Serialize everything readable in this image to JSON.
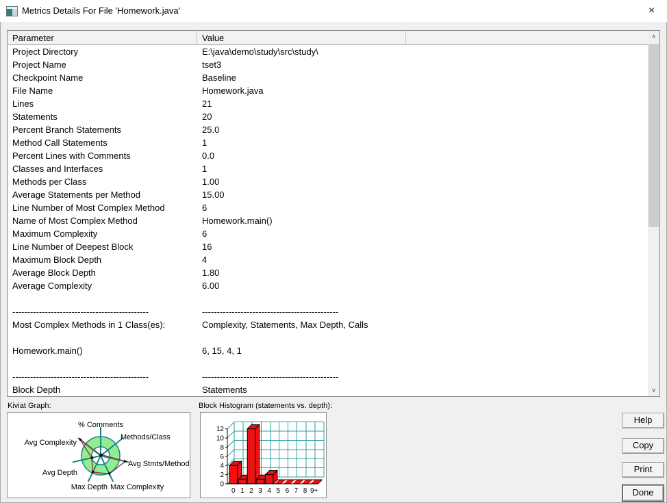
{
  "window": {
    "title": "Metrics Details For File 'Homework.java'",
    "close_glyph": "×",
    "app_icon": "metrics-app-icon"
  },
  "table": {
    "headers": [
      "Parameter",
      "Value",
      ""
    ],
    "rows": [
      [
        "Project Directory",
        "E:\\java\\demo\\study\\src\\study\\"
      ],
      [
        "Project Name",
        "tset3"
      ],
      [
        "Checkpoint Name",
        "Baseline"
      ],
      [
        "File Name",
        "Homework.java"
      ],
      [
        "Lines",
        "21"
      ],
      [
        "Statements",
        "20"
      ],
      [
        "Percent Branch Statements",
        "25.0"
      ],
      [
        "Method Call Statements",
        "1"
      ],
      [
        "Percent Lines with Comments",
        "0.0"
      ],
      [
        "Classes and Interfaces",
        "1"
      ],
      [
        "Methods per Class",
        "1.00"
      ],
      [
        "Average Statements per Method",
        "15.00"
      ],
      [
        "Line Number of Most Complex Method",
        "6"
      ],
      [
        "Name of Most Complex Method",
        "Homework.main()"
      ],
      [
        "Maximum Complexity",
        "6"
      ],
      [
        "Line Number of Deepest Block",
        "16"
      ],
      [
        "Maximum Block Depth",
        "4"
      ],
      [
        "Average Block Depth",
        "1.80"
      ],
      [
        "Average Complexity",
        "6.00"
      ],
      [
        "",
        ""
      ],
      [
        "----------------------------------------------",
        "----------------------------------------------"
      ],
      [
        "Most Complex Methods in 1 Class(es):",
        "Complexity, Statements, Max Depth, Calls"
      ],
      [
        "",
        ""
      ],
      [
        "Homework.main()",
        "6, 15, 4, 1"
      ],
      [
        "",
        ""
      ],
      [
        "----------------------------------------------",
        "----------------------------------------------"
      ],
      [
        "Block Depth",
        "Statements"
      ]
    ]
  },
  "section_labels": {
    "kiviat": "Kiviat Graph:",
    "histogram": "Block Histogram (statements vs. depth):"
  },
  "buttons": {
    "help": "Help",
    "copy": "Copy",
    "print": "Print",
    "done": "Done"
  },
  "scrollbar": {
    "up_glyph": "∧",
    "down_glyph": "∨"
  },
  "chart_data": [
    {
      "type": "radar",
      "title": "Kiviat Graph",
      "axes": [
        "% Comments",
        "Methods/Class",
        "Avg Stmts/Method",
        "Max Complexity",
        "Max Depth",
        "Avg Depth",
        "Avg Complexity"
      ],
      "values_fraction_of_outer_ring": [
        0.04,
        0.08,
        1.32,
        1.05,
        0.95,
        0.48,
        1.38
      ],
      "ring_inner_fraction": 0.47,
      "colors": {
        "ring_fill": "#90ee90",
        "axis": "#1d8383",
        "polygon": "#9c3333",
        "marker": "#000000"
      }
    },
    {
      "type": "bar",
      "title": "Block Histogram (statements vs. depth)",
      "xlabel": "depth",
      "ylabel": "statements",
      "categories": [
        "0",
        "1",
        "2",
        "3",
        "4",
        "5",
        "6",
        "7",
        "8",
        "9+"
      ],
      "values": [
        4,
        1,
        12,
        1,
        2,
        0,
        0,
        0,
        0,
        0
      ],
      "yticks": [
        0,
        2,
        4,
        6,
        8,
        10,
        12
      ],
      "ylim": [
        0,
        13
      ],
      "bar_color": "#ee1111",
      "grid_color": "#2e9e9e"
    }
  ]
}
